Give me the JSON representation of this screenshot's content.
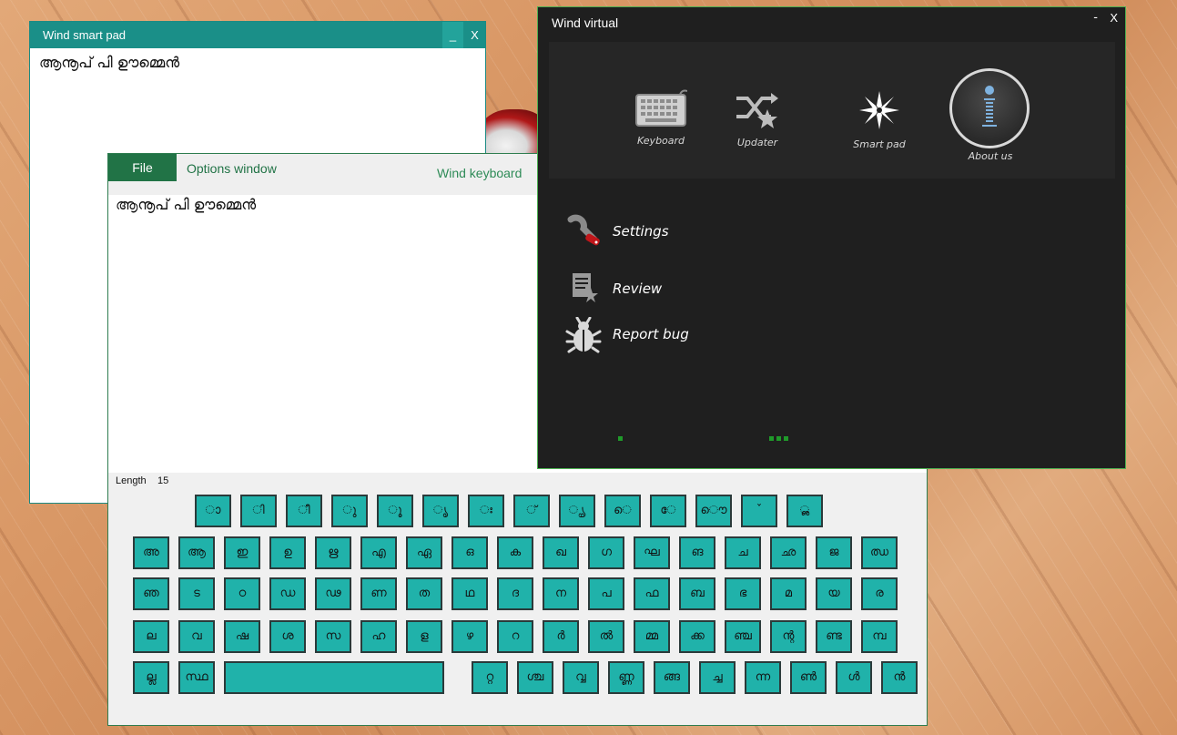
{
  "smart_pad": {
    "title": "Wind smart pad",
    "minimize": "_",
    "close": "X",
    "content": "ആനൂപ് പി ഊമ്മെൻ"
  },
  "options_window": {
    "file_label": "File",
    "options_label": "Options window",
    "keyboard_label": "Wind keyboard",
    "editor_text": "ആനൂപ് പി ഊമ്മെൻ",
    "length_label": "Length",
    "length_value": "15",
    "keyboard_rows": [
      [
        "ാ",
        "ി",
        "ീ",
        "ു",
        "ൂ",
        "ൃ",
        "ഃ",
        "്",
        "ൄ",
        "െ",
        "േ",
        "ൌ",
        "ˇ",
        "ൢ"
      ],
      [
        "അ",
        "ആ",
        "ഇ",
        "ഉ",
        "ഋ",
        "എ",
        "ഏ",
        "ഒ",
        "ക",
        "ഖ",
        "ഗ",
        "ഘ",
        "ങ",
        "ച",
        "ഛ",
        "ജ",
        "ഝ"
      ],
      [
        "ഞ",
        "ട",
        "ഠ",
        "ഡ",
        "ഢ",
        "ണ",
        "ത",
        "ഥ",
        "ദ",
        "ന",
        "പ",
        "ഫ",
        "ബ",
        "ഭ",
        "മ",
        "യ",
        "ര"
      ],
      [
        "ല",
        "വ",
        "ഷ",
        "ശ",
        "സ",
        "ഹ",
        "ള",
        "ഴ",
        "റ",
        "ർ",
        "ൽ",
        "മ്മ",
        "ക്ക",
        "ഞ്ച",
        "ന്റ",
        "ണ്ട",
        "മ്പ"
      ],
      [
        "ല്ല",
        "സ്ഥ",
        "",
        "റ്റ",
        "ശ്ച",
        "വ്വ",
        "ണ്ണ",
        "ങ്ങ",
        "ച്ച",
        "ന്ന",
        "ൺ",
        "ൾ",
        "ൻ"
      ]
    ]
  },
  "wind_virtual": {
    "title": "Wind virtual",
    "minimize": "-",
    "close": "X",
    "tiles": {
      "keyboard": "Keyboard",
      "updater": "Updater",
      "smart_pad": "Smart pad",
      "about": "About us"
    },
    "menu": {
      "settings": "Settings",
      "review": "Review",
      "report_bug": "Report bug"
    }
  }
}
